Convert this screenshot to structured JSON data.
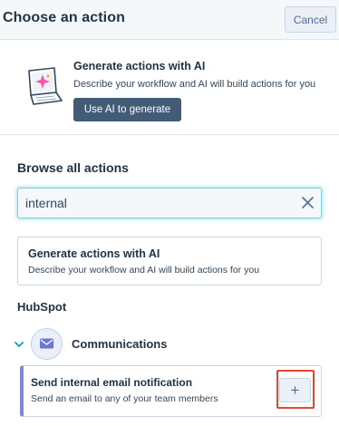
{
  "header": {
    "title": "Choose an action",
    "cancel_label": "Cancel"
  },
  "promo": {
    "title": "Generate actions with AI",
    "description": "Describe your workflow and AI will build actions for you",
    "button_label": "Use AI to generate"
  },
  "browse": {
    "heading": "Browse all actions",
    "search_value": "internal"
  },
  "ai_card": {
    "title": "Generate actions with AI",
    "description": "Describe your workflow and AI will build actions for you"
  },
  "section": {
    "heading": "HubSpot"
  },
  "category": {
    "label": "Communications",
    "icon": "envelope-icon"
  },
  "action": {
    "title": "Send internal email notification",
    "description": "Send an email to any of your team members",
    "add_label": "+"
  },
  "colors": {
    "primary_button": "#425b76",
    "search_focus": "#7fd1de",
    "category_accent": "#7f8ad7",
    "highlight": "#e5472e"
  }
}
